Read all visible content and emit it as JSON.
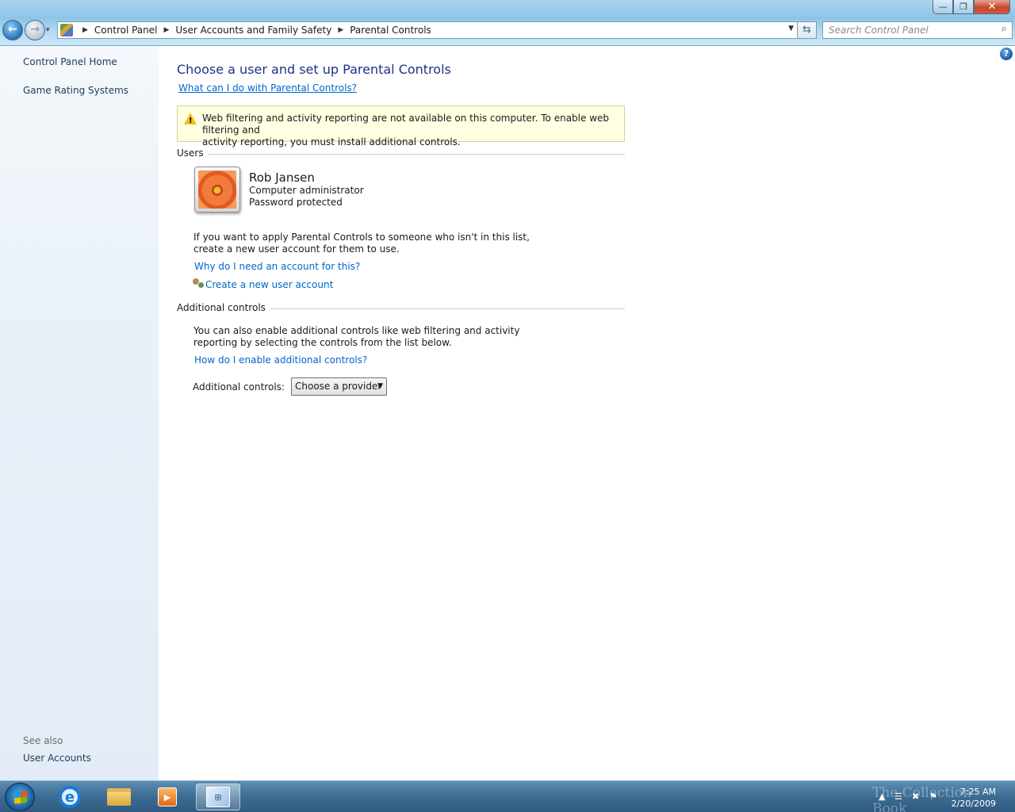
{
  "window": {
    "minimize_glyph": "—",
    "maximize_glyph": "❐",
    "close_glyph": "✕"
  },
  "nav": {
    "back_glyph": "←",
    "forward_glyph": "→",
    "history_glyph": "▾"
  },
  "address": {
    "crumbs": [
      "Control Panel",
      "User Accounts and Family Safety",
      "Parental Controls"
    ],
    "separator": "▶",
    "dropdown_glyph": "▼",
    "refresh_glyph": "⇆"
  },
  "search": {
    "placeholder": "Search Control Panel",
    "icon": "search-icon",
    "glyph": "⌕"
  },
  "left_pane": {
    "links": [
      "Control Panel Home",
      "Game Rating Systems"
    ],
    "see_also_heading": "See also",
    "see_also_links": [
      "User Accounts"
    ]
  },
  "main": {
    "help_glyph": "?",
    "title": "Choose a user and set up Parental Controls",
    "what_can_link": "What can I do with Parental Controls?",
    "warning": {
      "icon": "warning-icon",
      "glyph": "!",
      "line1": "Web filtering and activity reporting are not available on this computer. To enable web filtering and",
      "line2": "activity reporting, you must install additional controls."
    },
    "users_heading": "Users",
    "user": {
      "name": "Rob Jansen",
      "role": "Computer administrator",
      "status": "Password protected"
    },
    "apply_text_line1": "If you want to apply Parental Controls to someone who isn't in this list,",
    "apply_text_line2": "create a new user account for them to use.",
    "why_link": "Why do I need an account for this?",
    "create_link": "Create a new user account",
    "additional_heading": "Additional controls",
    "additional_text_line1": "You can also enable additional controls like web filtering and activity",
    "additional_text_line2": "reporting by selecting the controls from the list below.",
    "how_link": "How do I enable additional controls?",
    "controls_label": "Additional controls:",
    "provider_select": {
      "selected": "Choose a provider",
      "arrow": "▼"
    }
  },
  "taskbar": {
    "apps": [
      "start-button",
      "internet-explorer",
      "windows-explorer",
      "media-player",
      "control-panel"
    ],
    "ie_glyph": "e",
    "media_glyph": "▶",
    "cp_glyph": "⊞",
    "tray_icons": [
      "show-hidden-icons-arrow",
      "network-icon",
      "volume-muted-icon",
      "action-center-flag-icon"
    ],
    "tray_glyphs": [
      "▲",
      "☰",
      "✖",
      "⚑"
    ],
    "time": "7:25 AM",
    "date": "2/20/2009",
    "watermark": "The Collection Book"
  },
  "colors": {
    "title": "#1e3287",
    "link": "#0066cc",
    "left_link": "#1e395b",
    "warning_bg": "#ffffe1"
  }
}
